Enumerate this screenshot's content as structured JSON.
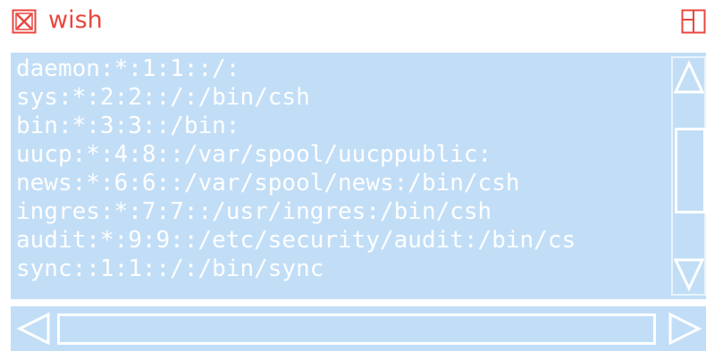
{
  "window": {
    "title": "wish",
    "close_icon": "close-x-icon",
    "resize_icon": "resize-icon",
    "title_color": "#e8473f"
  },
  "textarea": {
    "background": "#c2def7",
    "text_color": "#ffffff",
    "lines": [
      "daemon:*:1:1::/:",
      "sys:*:2:2::/:/bin/csh",
      "bin:*:3:3::/bin:",
      "uucp:*:4:8::/var/spool/uucppublic:",
      "news:*:6:6::/var/spool/news:/bin/csh",
      "ingres:*:7:7::/usr/ingres:/bin/csh",
      "audit:*:9:9::/etc/security/audit:/bin/cs",
      "sync::1:1::/:/bin/sync"
    ]
  },
  "scrollbars": {
    "vertical": {
      "up_icon": "arrow-up-icon",
      "down_icon": "arrow-down-icon"
    },
    "horizontal": {
      "left_icon": "arrow-left-icon",
      "right_icon": "arrow-right-icon"
    }
  }
}
